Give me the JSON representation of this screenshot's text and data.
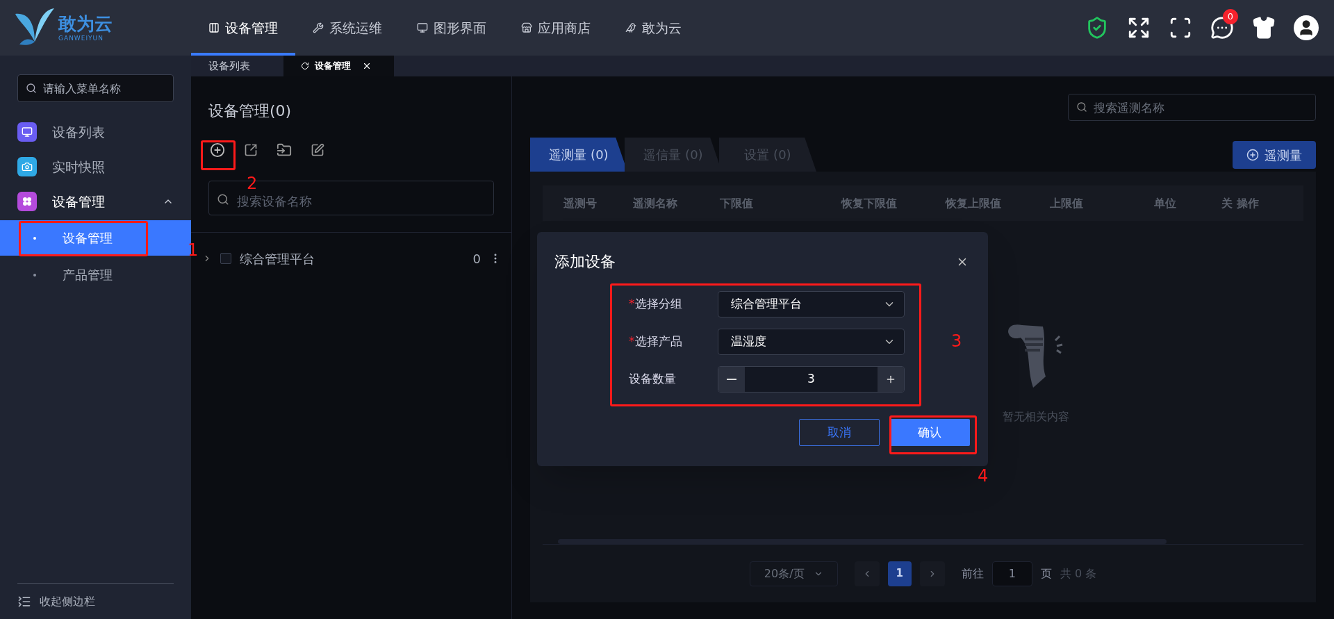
{
  "logo": {
    "name": "敢为云",
    "subtitle": "GANWEIYUN"
  },
  "top_nav": [
    {
      "label": "设备管理",
      "selected": true
    },
    {
      "label": "系统运维",
      "selected": false
    },
    {
      "label": "图形界面",
      "selected": false
    },
    {
      "label": "应用商店",
      "selected": false
    },
    {
      "label": "敢为云",
      "selected": false
    }
  ],
  "notification_count": "0",
  "page_tabs": [
    {
      "label": "设备列表",
      "selected": false
    },
    {
      "label": "设备管理",
      "selected": true
    }
  ],
  "sidebar": {
    "search": {
      "placeholder": "请输入菜单名称"
    },
    "items": [
      {
        "label": "设备列表",
        "color": "#6a5df2"
      },
      {
        "label": "实时快照",
        "color": "#2fa9e6"
      },
      {
        "label": "设备管理",
        "color": "#b44bdc",
        "expanded": true,
        "children": [
          {
            "label": "设备管理",
            "selected": true
          },
          {
            "label": "产品管理",
            "selected": false
          }
        ]
      }
    ],
    "collapse_label": "收起侧边栏"
  },
  "device_panel": {
    "title": "设备管理(0)",
    "search": {
      "placeholder": "搜索设备名称"
    },
    "tree": [
      {
        "label": "综合管理平台",
        "count": "0",
        "expanded": false,
        "checked": false
      }
    ]
  },
  "points_panel": {
    "search": {
      "placeholder": "搜索遥测名称"
    },
    "tabs": [
      {
        "label": "遥测量 (0)",
        "selected": true
      },
      {
        "label": "遥信量 (0)",
        "selected": false
      },
      {
        "label": "设置 (0)",
        "selected": false
      }
    ],
    "add_button": "遥测量",
    "table": {
      "columns": [
        "遥测号",
        "遥测名称",
        "下限值",
        "恢复下限值",
        "恢复上限值",
        "上限值",
        "单位",
        "关",
        "操作"
      ]
    },
    "empty_text": "暂无相关内容",
    "pagination": {
      "page_size": "20条/页",
      "pages": [
        {
          "label": "1",
          "selected": true
        }
      ],
      "goto_label": "前往",
      "goto_value": "1",
      "page_suffix": "页",
      "total": "共 0 条"
    }
  },
  "dialog": {
    "title": "添加设备",
    "fields": [
      {
        "kind": "select",
        "label": "选择分组",
        "required_mark": "*",
        "value": "综合管理平台"
      },
      {
        "kind": "select",
        "label": "选择产品",
        "required_mark": "*",
        "value": "温湿度"
      },
      {
        "kind": "number",
        "label": "设备数量",
        "value": "3"
      }
    ],
    "buttons": [
      {
        "label": "取消",
        "kind": "secondary"
      },
      {
        "label": "确认",
        "kind": "primary"
      }
    ]
  },
  "annotations": [
    {
      "label": "1"
    },
    {
      "label": "2"
    },
    {
      "label": "3"
    },
    {
      "label": "4"
    }
  ]
}
